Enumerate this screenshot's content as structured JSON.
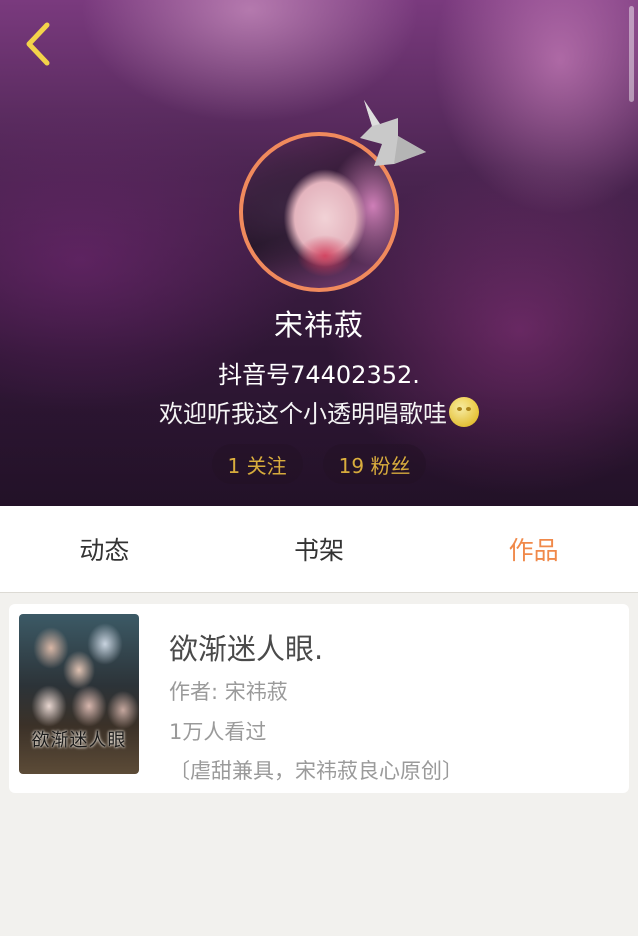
{
  "header": {
    "username": "宋祎菽",
    "douyin_id": "抖音号74402352.",
    "bio": "欢迎听我这个小透明唱歌哇",
    "stats": {
      "following": "1 关注",
      "followers": "19 粉丝"
    }
  },
  "tabs": [
    {
      "label": "动态",
      "active": false
    },
    {
      "label": "书架",
      "active": false
    },
    {
      "label": "作品",
      "active": true
    }
  ],
  "works": [
    {
      "cover_text": "欲渐迷人眼",
      "title": "欲渐迷人眼.",
      "author": "作者: 宋祎菽",
      "views": "1万人看过",
      "description": "〔虐甜兼具，宋祎菽良心原创〕"
    }
  ],
  "colors": {
    "accent_orange": "#f0894a",
    "stat_yellow": "#f6c445",
    "back_arrow": "#f3d34a",
    "avatar_border": "#f08a5d"
  },
  "icons": {
    "back": "chevron-left-icon",
    "crown": "crown-icon",
    "emoji": "moon-face-emoji-icon"
  }
}
